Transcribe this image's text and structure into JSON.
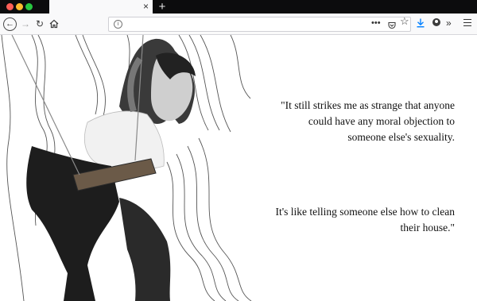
{
  "browser": {
    "tab_close_glyph": "×",
    "new_tab_glyph": "+",
    "url_value": "",
    "page_actions_glyph": "•••",
    "overflow_glyph": "»",
    "icons": [
      "back-icon",
      "forward-icon",
      "reload-icon",
      "home-icon",
      "info-icon",
      "pocket-icon",
      "bookmark-star-icon",
      "download-icon",
      "account-icon",
      "overflow-icon",
      "menu-icon"
    ]
  },
  "page": {
    "quote_part1": "\"It still strikes me as strange that anyone could have any moral objection to someone else's sexuality.",
    "quote_part2": "It's like telling someone else how to clean their house.\""
  },
  "colors": {
    "accent_download": "#0a84ff",
    "titlebar": "#0c0c0d",
    "toolbar": "#f9f9fa",
    "close_dot": "#fe5f57",
    "minimize_dot": "#febc2e",
    "zoom_dot": "#28c840"
  }
}
